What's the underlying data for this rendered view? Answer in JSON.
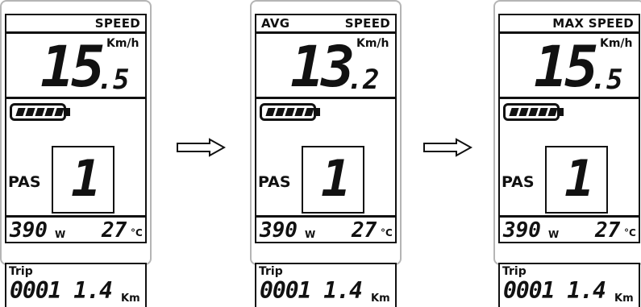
{
  "panels": [
    {
      "header_left": "",
      "header_right": "SPEED",
      "speed_int": "15",
      "speed_dec": "5",
      "speed_unit": "Km/h",
      "battery_bars": 5,
      "pas_label": "PAS",
      "pas_level": "1",
      "power": "390",
      "power_unit": "W",
      "temperature": "27",
      "temp_unit": "°C",
      "trip_label": "Trip",
      "trip_value": "0001 1.4",
      "trip_unit": "Km"
    },
    {
      "header_left": "AVG",
      "header_right": "SPEED",
      "speed_int": "13",
      "speed_dec": "2",
      "speed_unit": "Km/h",
      "battery_bars": 5,
      "pas_label": "PAS",
      "pas_level": "1",
      "power": "390",
      "power_unit": "W",
      "temperature": "27",
      "temp_unit": "°C",
      "trip_label": "Trip",
      "trip_value": "0001 1.4",
      "trip_unit": "Km"
    },
    {
      "header_left": "",
      "header_right": "MAX SPEED",
      "speed_int": "15",
      "speed_dec": "5",
      "speed_unit": "Km/h",
      "battery_bars": 5,
      "pas_label": "PAS",
      "pas_level": "1",
      "power": "390",
      "power_unit": "W",
      "temperature": "27",
      "temp_unit": "°C",
      "trip_label": "Trip",
      "trip_value": "0001 1.4",
      "trip_unit": "Km"
    }
  ],
  "arrows": [
    "right-arrow",
    "right-arrow"
  ]
}
